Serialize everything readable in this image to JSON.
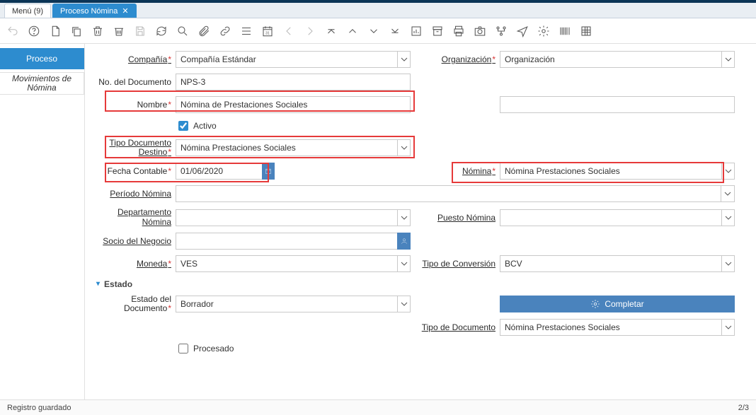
{
  "tabs": [
    {
      "label": "Menú (9)",
      "active": false
    },
    {
      "label": "Proceso Nómina",
      "active": true
    }
  ],
  "side": [
    {
      "label": "Proceso",
      "active": true
    },
    {
      "label": "Movimientos de Nómina",
      "active": false
    }
  ],
  "labels": {
    "compania": "Compañía",
    "organizacion": "Organización",
    "no_doc": "No. del Documento",
    "nombre": "Nombre",
    "activo": "Activo",
    "tipo_doc_dest": "Tipo Documento Destino",
    "fecha_contable": "Fecha Contable",
    "nomina": "Nómina",
    "periodo": "Período Nómina",
    "departamento": "Departamento Nómina",
    "puesto": "Puesto Nómina",
    "socio": "Socio del Negocio",
    "moneda": "Moneda",
    "tipo_conv": "Tipo de Conversión",
    "estado_sec": "Estado",
    "estado_doc": "Estado del Documento",
    "completar": "Completar",
    "tipo_doc": "Tipo de Documento",
    "procesado": "Procesado"
  },
  "values": {
    "compania": "Compañía Estándar",
    "organizacion": "Organización",
    "no_doc": "NPS-3",
    "nombre": "Nómina de Prestaciones Sociales",
    "activo": true,
    "tipo_doc_dest": "Nómina Prestaciones Sociales",
    "fecha_contable": "01/06/2020",
    "nomina": "Nómina Prestaciones Sociales",
    "periodo": "",
    "departamento": "",
    "puesto": "",
    "socio": "",
    "moneda": "VES",
    "tipo_conv": "BCV",
    "estado_doc": "Borrador",
    "tipo_doc": "Nómina Prestaciones Sociales",
    "procesado": false
  },
  "status": {
    "msg": "Registro guardado",
    "pager": "2/3"
  }
}
